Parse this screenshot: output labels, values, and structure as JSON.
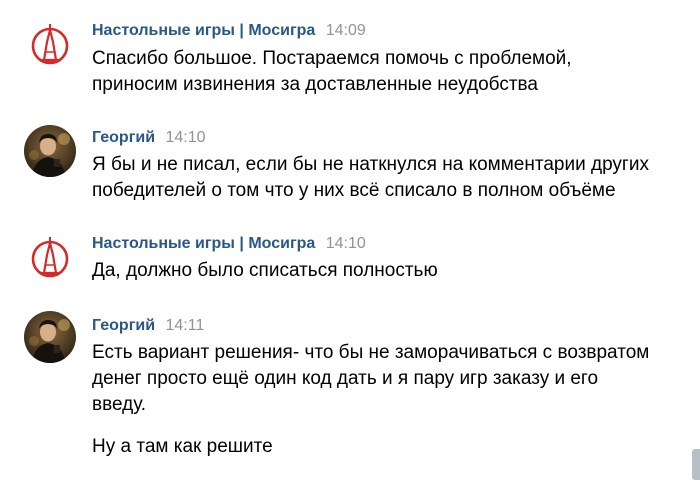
{
  "messages": [
    {
      "author": "Настольные игры | Мосигра",
      "time": "14:09",
      "avatar": "mosigra-logo",
      "lines": [
        "Спасибо большое. Постараемся помочь с проблемой,",
        "приносим извинения за доставленные неудобства"
      ]
    },
    {
      "author": "Георгий",
      "time": "14:10",
      "avatar": "user-photo",
      "lines": [
        "Я бы и не писал, если бы не наткнулся на комментарии других",
        "победителей о том что у них всё списало в полном объёме"
      ]
    },
    {
      "author": "Настольные игры | Мосигра",
      "time": "14:10",
      "avatar": "mosigra-logo",
      "lines": [
        "Да, должно было списаться полностью"
      ]
    },
    {
      "author": "Георгий",
      "time": "14:11",
      "avatar": "user-photo",
      "lines": [
        "Есть вариант решения- что бы не заморачиваться с возвратом",
        "денег просто ещё один код дать и я пару игр заказу и его",
        "введу."
      ],
      "extra": "Ну а там как решите"
    }
  ],
  "colors": {
    "author": "#2a5885",
    "time": "#939393",
    "logo_red": "#d62a2a"
  }
}
